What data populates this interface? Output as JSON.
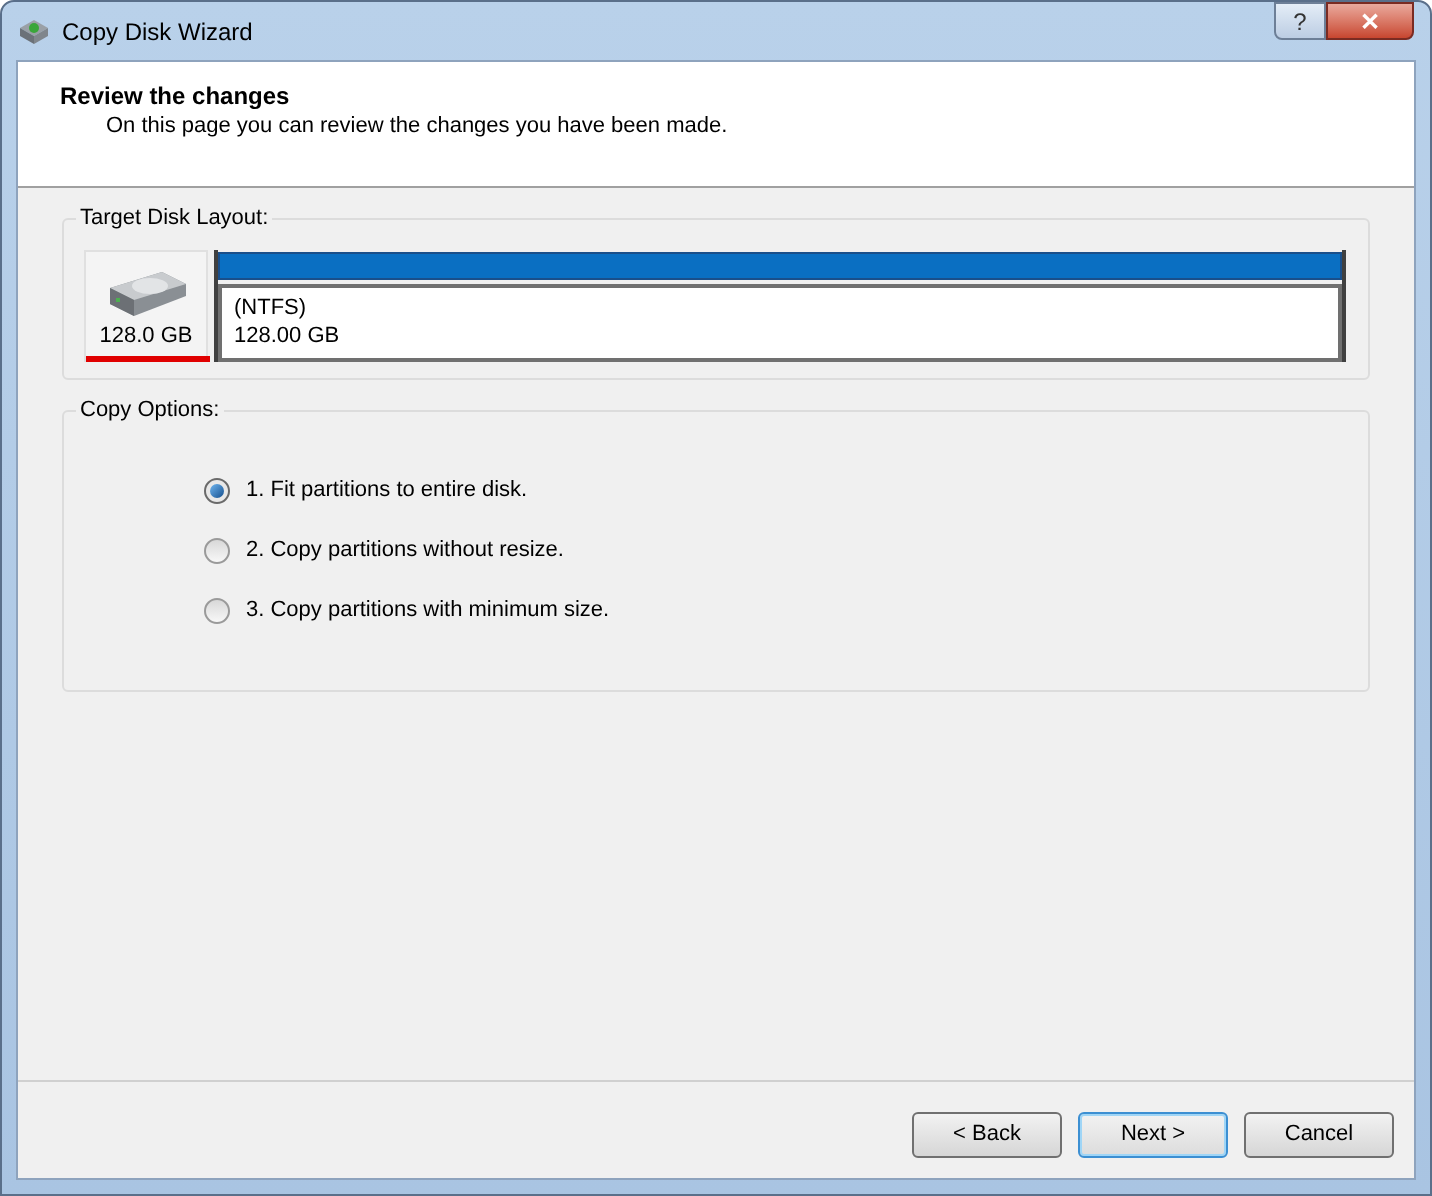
{
  "window": {
    "title": "Copy Disk Wizard",
    "controls": [
      "?",
      "✕"
    ]
  },
  "header": {
    "title": "Review the changes",
    "subtitle": "On this page you can review the changes you have been made."
  },
  "target_disk_layout": {
    "label": "Target Disk Layout:",
    "disk": {
      "size": "128.0 GB"
    },
    "partitions": [
      {
        "file_system": "(NTFS)",
        "size": "128.00 GB"
      }
    ]
  },
  "copy_options": {
    "label": "Copy Options:",
    "options": [
      {
        "label": "1. Fit partitions to entire disk.",
        "selected": true
      },
      {
        "label": "2. Copy partitions without resize.",
        "selected": false
      },
      {
        "label": "3. Copy partitions with minimum size.",
        "selected": false
      }
    ]
  },
  "buttons": [
    {
      "label": "< Back",
      "default": false
    },
    {
      "label": "Next >",
      "default": true
    },
    {
      "label": "Cancel",
      "default": false
    }
  ]
}
